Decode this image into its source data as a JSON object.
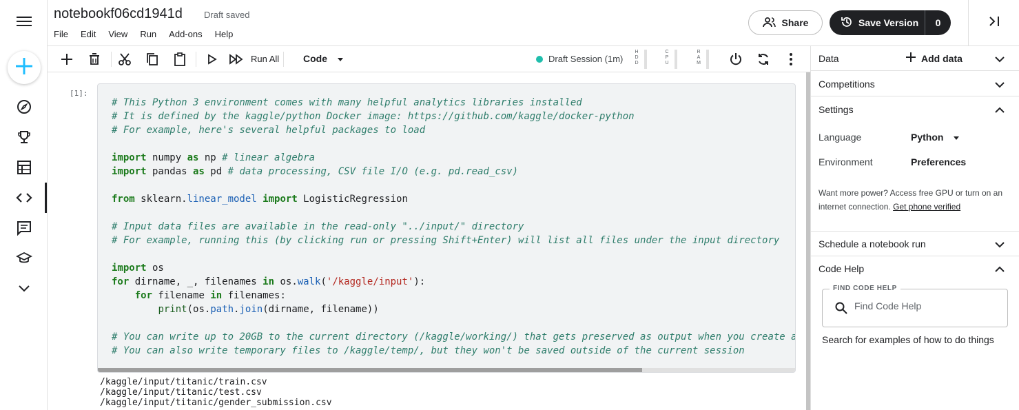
{
  "app": {
    "notebook_title": "notebookf06cd1941d",
    "save_status": "Draft saved",
    "menu": [
      "File",
      "Edit",
      "View",
      "Run",
      "Add-ons",
      "Help"
    ],
    "share_label": "Share",
    "save_version_label": "Save Version",
    "version_count": "0"
  },
  "rail": {
    "icons": [
      "menu-icon",
      "create-icon",
      "compass-icon",
      "trophy-icon",
      "table-icon",
      "code-icon",
      "discussion-icon",
      "school-icon",
      "chevron-down-icon"
    ],
    "active": "code-icon"
  },
  "toolbar": {
    "run_all_label": "Run All",
    "cell_type": "Code",
    "session_label": "Draft Session (1m)",
    "session_status_color": "#20beac",
    "meters": [
      "HDD",
      "CPU",
      "RAM"
    ]
  },
  "cell": {
    "exec_count": "[1]:",
    "output_lines": [
      "/kaggle/input/titanic/train.csv",
      "/kaggle/input/titanic/test.csv",
      "/kaggle/input/titanic/gender_submission.csv"
    ]
  },
  "panel": {
    "data_title": "Data",
    "add_data_label": "Add data",
    "competitions_title": "Competitions",
    "settings_title": "Settings",
    "language_label": "Language",
    "language_value": "Python",
    "environment_label": "Environment",
    "environment_value": "Preferences",
    "power_note": "Want more power? Access free GPU or turn on an internet connection.",
    "power_link": "Get phone verified",
    "schedule_title": "Schedule a notebook run",
    "code_help_title": "Code Help",
    "find_code_help_legend": "FIND CODE HELP",
    "find_code_help_placeholder": "Find Code Help",
    "code_help_hint": "Search for examples of how to do things"
  },
  "colors": {
    "dark": "#202124",
    "accent_blue": "#20beff",
    "session_green": "#20beac"
  }
}
